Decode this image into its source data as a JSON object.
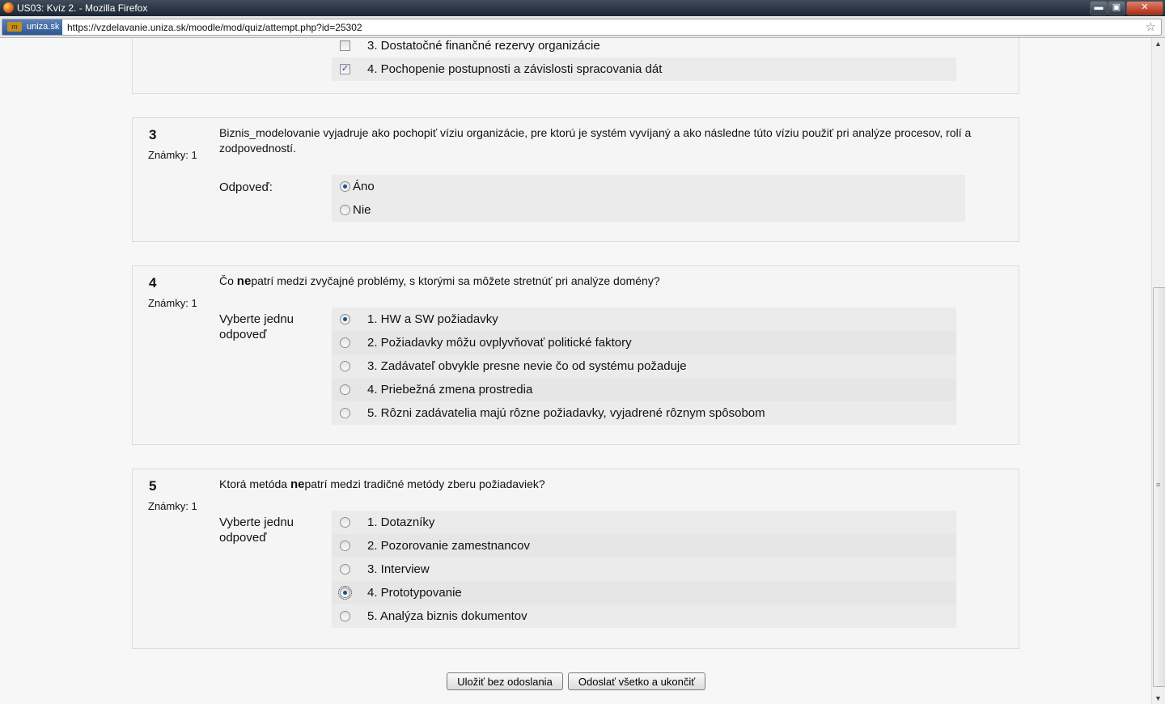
{
  "window": {
    "title": "US03: Kvíz 2. - Mozilla Firefox",
    "minimize": "▬",
    "maximize": "▣",
    "close": "✕"
  },
  "urlbar": {
    "site_identity": "uniza.sk",
    "url": "https://vzdelavanie.uniza.sk/moodle/mod/quiz/attempt.php?id=25302",
    "logo_glyph": "m"
  },
  "q2": {
    "options": [
      {
        "label": "3. Dostatočné finančné rezervy organizácie",
        "checked": false
      },
      {
        "label": "4. Pochopenie postupnosti a závislosti spracovania dát",
        "checked": true
      }
    ]
  },
  "q3": {
    "number": "3",
    "marks": "Známky: 1",
    "text": "Biznis_modelovanie vyjadruje ako pochopiť víziu organizácie, pre ktorú je systém vyvíjaný a ako následne túto víziu použiť pri analýze procesov, rolí a zodpovedností.",
    "answer_label": "Odpoveď:",
    "options": [
      {
        "label": "Áno",
        "selected": true
      },
      {
        "label": "Nie",
        "selected": false
      }
    ]
  },
  "q4": {
    "number": "4",
    "marks": "Známky: 1",
    "text_before": "Čo ",
    "text_bold": "ne",
    "text_after": "patrí medzi zvyčajné problémy, s ktorými sa môžete stretnúť pri analýze domény?",
    "answer_label": "Vyberte jednu odpoveď",
    "options": [
      {
        "label": "1. HW a SW požiadavky",
        "selected": true
      },
      {
        "label": "2. Požiadavky môžu ovplyvňovať politické faktory",
        "selected": false
      },
      {
        "label": "3. Zadávateľ obvykle presne nevie čo od systému požaduje",
        "selected": false
      },
      {
        "label": "4. Priebežná zmena prostredia",
        "selected": false
      },
      {
        "label": "5. Rôzni zadávatelia majú rôzne požiadavky, vyjadrené rôznym spôsobom",
        "selected": false
      }
    ]
  },
  "q5": {
    "number": "5",
    "marks": "Známky: 1",
    "text_before": "Ktorá metóda ",
    "text_bold": "ne",
    "text_after": "patrí medzi tradičné metódy zberu požiadaviek?",
    "answer_label": "Vyberte jednu odpoveď",
    "options": [
      {
        "label": "1. Dotazníky",
        "selected": false
      },
      {
        "label": "2. Pozorovanie zamestnancov",
        "selected": false
      },
      {
        "label": "3. Interview",
        "selected": false
      },
      {
        "label": "4. Prototypovanie",
        "selected": true
      },
      {
        "label": "5. Analýza biznis dokumentov",
        "selected": false
      }
    ]
  },
  "buttons": {
    "save": "Uložiť bez odoslania",
    "submit": "Odoslať všetko a ukončiť"
  },
  "scrollbar": {
    "up": "▲",
    "down": "▼",
    "grip": "≡"
  }
}
